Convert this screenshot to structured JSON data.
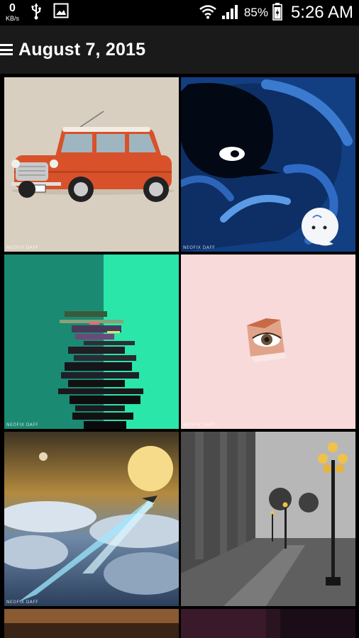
{
  "status_bar": {
    "data_rate_value": "0",
    "data_rate_unit": "KB/s",
    "battery_percent": "85%",
    "time": "5:26 AM",
    "icons": [
      "usb-icon",
      "gallery-icon",
      "wifi-icon",
      "signal-icon",
      "battery-icon"
    ]
  },
  "app_bar": {
    "title": "August 7, 2015",
    "menu_icon": "menu-icon"
  },
  "grid": {
    "tiles": [
      {
        "subject": "orange mini car on beige",
        "watermark": "NEOFIX DAFF"
      },
      {
        "subject": "blue swirl creature",
        "watermark": "NEOFIX DAFF"
      },
      {
        "subject": "glitch figure on teal",
        "watermark": "NEOFIX DAFF"
      },
      {
        "subject": "eye peeking through pink paper",
        "watermark": "NEOFIX DAFF"
      },
      {
        "subject": "ship over clouds at sunset",
        "watermark": "NEOFIX DAFF"
      },
      {
        "subject": "rainy street with lamp posts",
        "watermark": ""
      },
      {
        "subject": "warm partial tile",
        "watermark": ""
      },
      {
        "subject": "dark partial tile",
        "watermark": ""
      }
    ]
  },
  "colors": {
    "app_bar_bg": "#1a1a1a",
    "status_bar_bg": "#000000",
    "grid_bg": "#000000"
  }
}
